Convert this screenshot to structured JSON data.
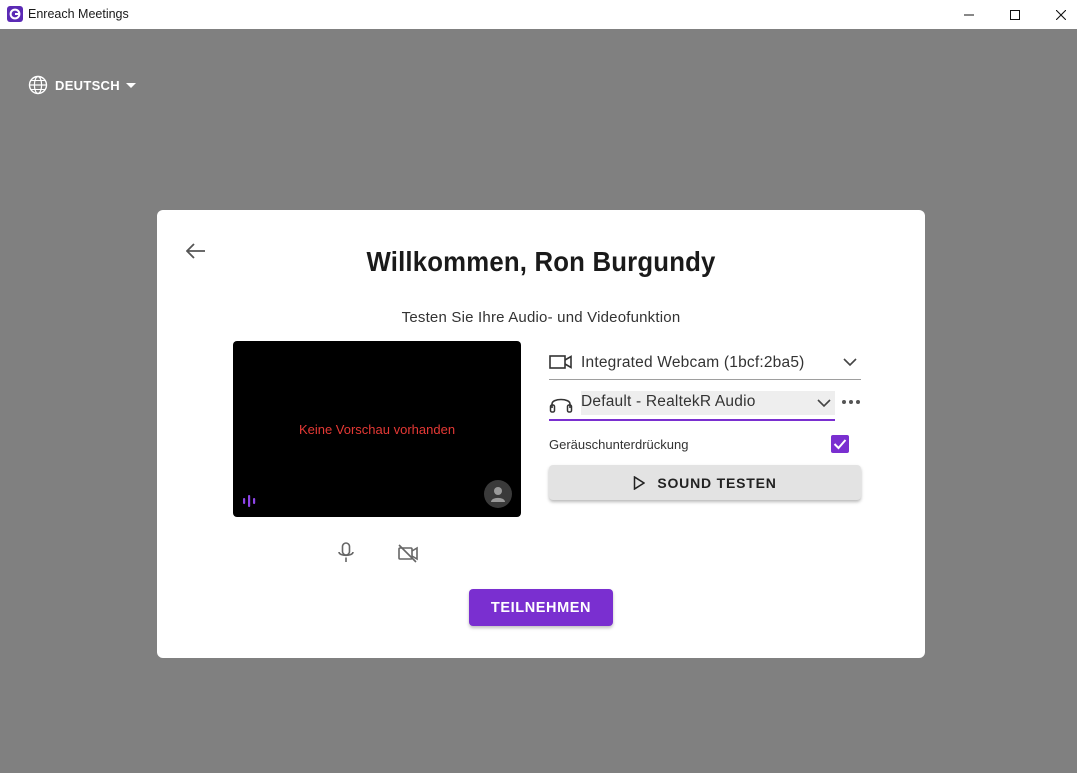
{
  "window": {
    "title": "Enreach Meetings"
  },
  "language": {
    "label": "DEUTSCH"
  },
  "card": {
    "welcome": "Willkommen, Ron Burgundy",
    "subtitle": "Testen Sie Ihre Audio- und Videofunktion",
    "preview_text": "Keine Vorschau vorhanden",
    "camera_device": "Integrated Webcam (1bcf:2ba5)",
    "audio_device": "Default - RealtekR Audio",
    "noise_suppression_label": "Geräuschunterdrückung",
    "noise_suppression_checked": true,
    "sound_test_label": "SOUND TESTEN",
    "join_label": "TEILNEHMEN"
  },
  "colors": {
    "accent": "#7a2fd0",
    "background": "#808080",
    "preview_text": "#e53935"
  },
  "icons": {
    "app": "enreach-logo-icon",
    "language": "globe-icon",
    "back": "arrow-left-icon",
    "camera": "video-camera-icon",
    "audio": "headset-icon",
    "mic": "microphone-icon",
    "cam_off": "camera-off-icon",
    "more": "more-horizontal-icon"
  }
}
